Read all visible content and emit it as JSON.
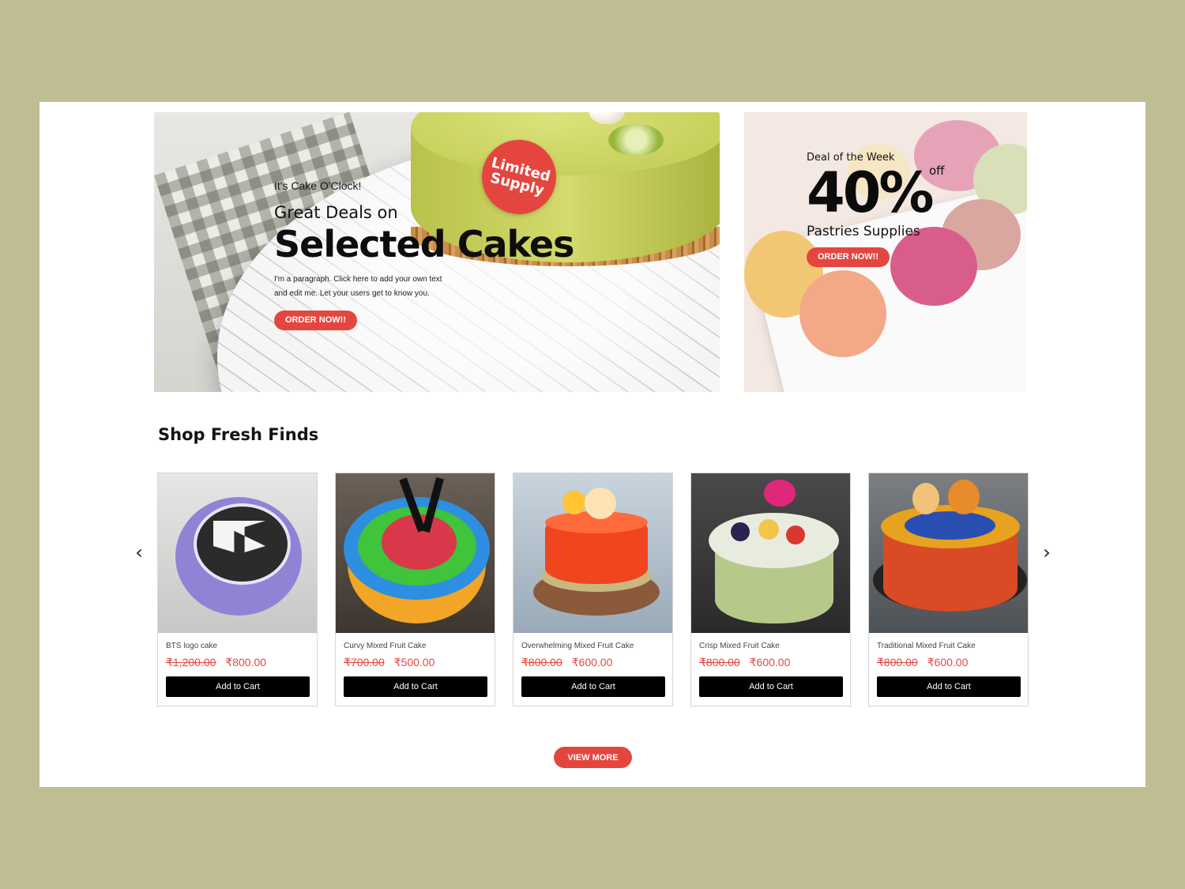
{
  "hero": {
    "badge": "Limited\nSupply",
    "kicker": "It's Cake O'Clock!",
    "subtitle": "Great Deals on",
    "title": "Selected Cakes",
    "paragraph": "I'm a paragraph. Click here to add your own text and edit me. Let your users get to know you.",
    "button": "ORDER NOW!!"
  },
  "deal": {
    "kicker": "Deal of the Week",
    "percent": "40%",
    "off": "off",
    "subtitle": "Pastries Supplies",
    "button": "ORDER NOW!!"
  },
  "shop": {
    "title": "Shop Fresh Finds",
    "prev_icon": "chevron-left-icon",
    "next_icon": "chevron-right-icon",
    "prev_glyph": "‹",
    "next_glyph": "›",
    "products": [
      {
        "name": "BTS logo cake",
        "old_price": "₹1,200.00",
        "price": "₹800.00",
        "cta": "Add to Cart"
      },
      {
        "name": "Curvy Mixed Fruit Cake",
        "old_price": "₹700.00",
        "price": "₹500.00",
        "cta": "Add to Cart"
      },
      {
        "name": "Overwhelming Mixed Fruit Cake",
        "old_price": "₹800.00",
        "price": "₹600.00",
        "cta": "Add to Cart"
      },
      {
        "name": "Crisp Mixed Fruit Cake",
        "old_price": "₹800.00",
        "price": "₹600.00",
        "cta": "Add to Cart"
      },
      {
        "name": "Traditional Mixed Fruit Cake",
        "old_price": "₹800.00",
        "price": "₹600.00",
        "cta": "Add to Cart"
      }
    ],
    "view_more": "VIEW MORE"
  },
  "colors": {
    "outer_background": "#bfbd92",
    "accent_red": "#e4463f",
    "button_black": "#000000"
  }
}
